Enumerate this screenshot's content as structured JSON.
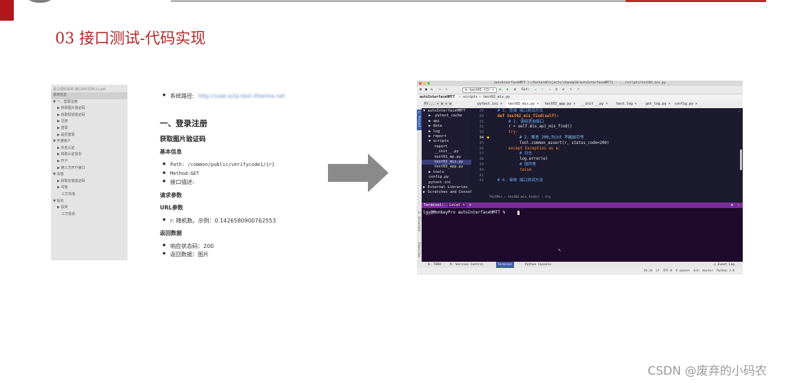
{
  "slide": {
    "title": "03 接口测试-代码实现",
    "watermark": "CSDN @废弃的小码农"
  },
  "doc_sidebar": {
    "file_name": "黑马理财系统-接口API文档(1).pdf",
    "items": [
      {
        "label": "系统信息",
        "indent": 0,
        "selected": true
      },
      {
        "label": "▼ 一、登录注册",
        "indent": 0
      },
      {
        "label": "▶ 获取图片验证码",
        "indent": 1
      },
      {
        "label": "▶ 获取短信验证码",
        "indent": 1
      },
      {
        "label": "▶ 注册",
        "indent": 1
      },
      {
        "label": "▶ 登录",
        "indent": 1
      },
      {
        "label": "▶ 是否登录",
        "indent": 1
      },
      {
        "label": "▼ 开通账户",
        "indent": 0
      },
      {
        "label": "▶ 实名认证",
        "indent": 1
      },
      {
        "label": "▶ 获取认证信息",
        "indent": 1
      },
      {
        "label": "▶ 开户",
        "indent": 1
      },
      {
        "label": "▶ 第三方开户接口",
        "indent": 1
      },
      {
        "label": "▼ 充值",
        "indent": 0
      },
      {
        "label": "▶ 获取充值验证码",
        "indent": 1
      },
      {
        "label": "▶ 充值",
        "indent": 1
      },
      {
        "label": "三方充值",
        "indent": 2
      },
      {
        "label": "▼ 投资",
        "indent": 0
      },
      {
        "label": "▶ 投资",
        "indent": 1
      },
      {
        "label": "三方投资",
        "indent": 2
      }
    ]
  },
  "doc": {
    "system_path_label": "系统路径:",
    "system_path_value": "http://user-p2p-test.itheima.net",
    "section_title": "一、登录注册",
    "subsection_title": "获取图片验证码",
    "basic_info_title": "基本信息",
    "path_line": "Path: /common/public/verifycode1/{r}",
    "method_line": "Method:GET",
    "desc_line": "接口描述:",
    "params_title": "请求参数",
    "url_params_title": "URL参数",
    "url_param_line": "r: 随机数。示例：0.1426580900762553",
    "response_title": "返回数据",
    "status_line": "响应状态码：200",
    "return_line": "返回数据：图片"
  },
  "ide": {
    "window_title": "autoInterfaceHMTT [~/PycharmProjects/chandq18/autoInterfaceHMTT] - .../scripts/test02_mis.py",
    "run_config": "test01 (2)",
    "git_label": "Git:",
    "breadcrumb": [
      "autoInterfaceHMTT",
      "scripts",
      "test02_mis.py"
    ],
    "project_button": "Pr...",
    "editor_tabs": [
      "pytest.ini",
      "test02_mis.py",
      "test03_app.py",
      "__init__.py",
      "test.log",
      "get_log.py",
      "config.py"
    ],
    "project_tree": [
      {
        "label": "▼ autoInterfaceHMTT",
        "depth": 0
      },
      {
        "label": "▶ .pytest_cache",
        "depth": 1
      },
      {
        "label": "▶ api",
        "depth": 1
      },
      {
        "label": "▶ data",
        "depth": 1
      },
      {
        "label": "▶ log",
        "depth": 1
      },
      {
        "label": "▶ report",
        "depth": 1
      },
      {
        "label": "▼ scripts",
        "depth": 1
      },
      {
        "label": "report",
        "depth": 2
      },
      {
        "label": "__init__.py",
        "depth": 2
      },
      {
        "label": "test01_mp.py",
        "depth": 2
      },
      {
        "label": "test02_mis.py",
        "depth": 2,
        "selected": true
      },
      {
        "label": "test03_app.py",
        "depth": 2
      },
      {
        "label": "▶ tools",
        "depth": 1
      },
      {
        "label": "config.py",
        "depth": 1
      },
      {
        "label": "pytest.ini",
        "depth": 1
      },
      {
        "label": "▶ External Libraries",
        "depth": 0
      },
      {
        "label": "▶ Scratches and Consoles",
        "depth": 0
      }
    ],
    "line_numbers": [
      "29",
      "30",
      "31",
      "32",
      "33",
      "34",
      "35",
      "36",
      "37",
      "38",
      "39",
      "40",
      "41",
      "42"
    ],
    "code_lines": [
      {
        "text": "# 3. 查询 接口测试方法",
        "kind": "comment",
        "indent": 0
      },
      {
        "text": "def test02_mis_find(self):",
        "kind": "def",
        "indent": 0
      },
      {
        "text": "# 1. 调用查询接口",
        "kind": "comment",
        "indent": 1
      },
      {
        "text": "r = self.mis.api_mis_find()",
        "kind": "code",
        "indent": 1
      },
      {
        "text": "try:",
        "kind": "keyword",
        "indent": 1
      },
      {
        "text": "# 2. 断言 200;为int 不能加引号",
        "kind": "comment",
        "indent": 2,
        "highlight": true
      },
      {
        "text": "Tool.common_assert(r, status_code=200)",
        "kind": "code",
        "indent": 2
      },
      {
        "text": "except Exception as e:",
        "kind": "keyword",
        "indent": 1
      },
      {
        "text": "# 日志",
        "kind": "comment",
        "indent": 2
      },
      {
        "text": "log.error(e)",
        "kind": "code",
        "indent": 2
      },
      {
        "text": "# 抛异常",
        "kind": "comment",
        "indent": 2
      },
      {
        "text": "raise",
        "kind": "keyword",
        "indent": 2
      },
      {
        "text": "",
        "kind": "code",
        "indent": 0
      },
      {
        "text": "# 4. 审核 接口测试方法",
        "kind": "comment",
        "indent": 0
      }
    ],
    "code_breadcrumb": "TestMis › test02_mis_find() › try",
    "terminal_label": "Terminal:",
    "terminal_tab": "Local",
    "terminal_prompt": "lgy@MonkeyPro autoInterfaceHMTT % ",
    "tool_tabs": [
      "6: TODO",
      "9: Version Control",
      "Terminal",
      "Python Console"
    ],
    "event_log": "Event Log",
    "status_bar": "34:14  LF  UTF-8  4 spaces  Git: master  Python 3.6",
    "side_labels": [
      "1: Project",
      "2: Structure",
      "2: Favorites"
    ]
  },
  "colors": {
    "accent_red": "#b2282a",
    "ide_bg": "#1c1a2e",
    "terminal_bg": "#1e0a2c",
    "terminal_header": "#7b2d9c",
    "highlight_line": "#1b1f7e",
    "arrow_gray": "#8a8a8a"
  }
}
